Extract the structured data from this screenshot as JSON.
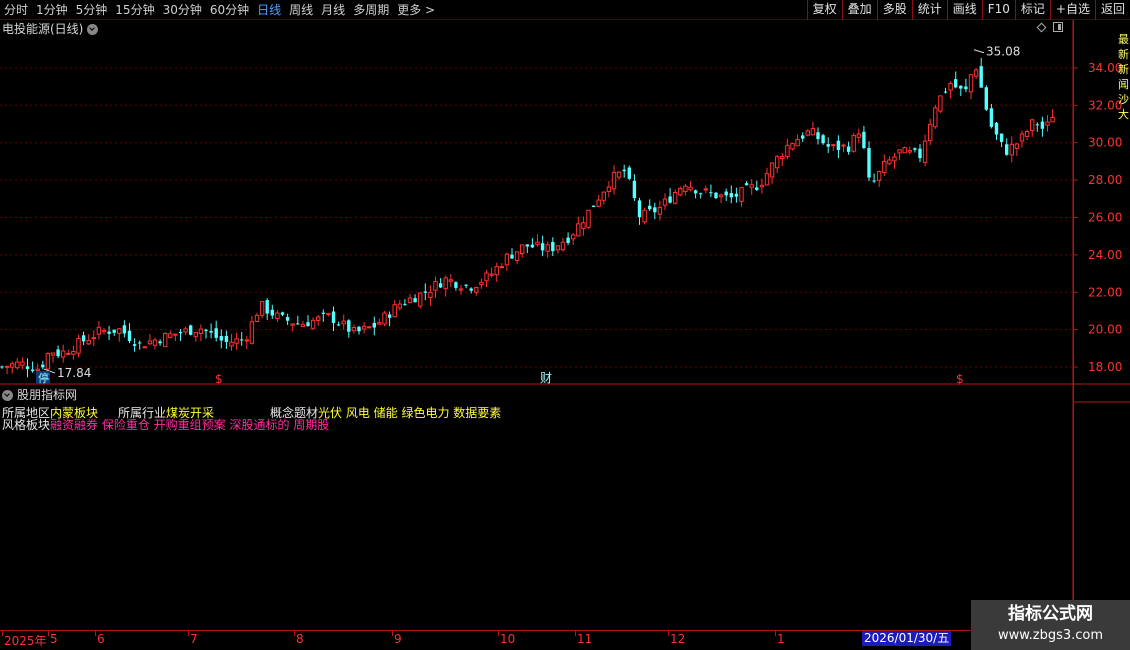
{
  "toolbar": {
    "periods": [
      "分时",
      "1分钟",
      "5分钟",
      "15分钟",
      "30分钟",
      "60分钟",
      "日线",
      "周线",
      "月线",
      "多周期",
      "更多 >"
    ],
    "active_period": "日线",
    "tools": [
      "复权",
      "叠加",
      "多股",
      "统计",
      "画线",
      "F10",
      "标记",
      "+自选",
      "返回"
    ]
  },
  "chart": {
    "title": "电投能源(日线)",
    "price_axis": [
      "34.00",
      "32.00",
      "30.00",
      "28.00",
      "26.00",
      "24.00",
      "22.00",
      "20.00",
      "18.00"
    ],
    "high_label": "35.08",
    "low_label": "17.84",
    "markers": {
      "stop": "停",
      "money1": "$",
      "finance": "财",
      "money2": "$"
    },
    "colors": {
      "up": "#ff3030",
      "down": "#54ffff",
      "grid": "#6a0000",
      "axis": "#b01818"
    }
  },
  "chart_data": {
    "type": "candlestick",
    "ylim": [
      17.2,
      35.6
    ],
    "x_axis": [
      "2025年",
      "5",
      "6",
      "7",
      "8",
      "9",
      "10",
      "11",
      "12",
      "1",
      "2026/01/30/五"
    ],
    "high": 35.08,
    "low": 17.84
  },
  "indicator": {
    "header": "股朋指标网",
    "region_label": "所属地区",
    "region_value": "内蒙板块",
    "industry_label": "所属行业",
    "industry_value": "煤炭开采",
    "concept_label": "概念题材",
    "concept_value": "光伏 风电 储能 绿色电力 数据要素",
    "style_label": "风格板块",
    "style_value": "融资融券 保险重仓 开购重组预案 深股通标的 周期股"
  },
  "date_axis": {
    "labels": [
      "2025年",
      "5",
      "6",
      "7",
      "8",
      "9",
      "10",
      "11",
      "12",
      "1"
    ],
    "cursor": "2026/01/30/五"
  },
  "side_panel": {
    "text": "最新新闻沙大"
  },
  "watermark": {
    "name": "指标公式网",
    "url": "www.zbgs3.com"
  }
}
